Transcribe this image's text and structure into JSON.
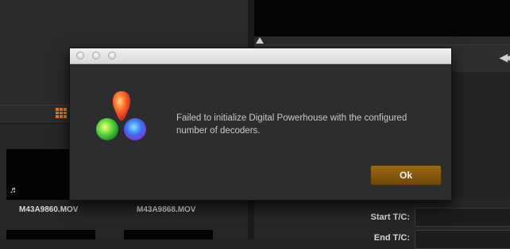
{
  "media_pool": {
    "clips": [
      {
        "name": "M43A9860.MOV",
        "icon": "music-note-icon"
      },
      {
        "name": "M43A9868.MOV"
      }
    ]
  },
  "inspector": {
    "start_tc_label": "Start T/C:",
    "end_tc_label": "End T/C:"
  },
  "dialog": {
    "message_line1": "Failed to initialize Digital Powerhouse with the configured",
    "message_line2": "number of decoders.",
    "ok_label": "Ok",
    "logo_icon": "davinci-resolve-logo",
    "accent_color": "#8a5c10"
  }
}
